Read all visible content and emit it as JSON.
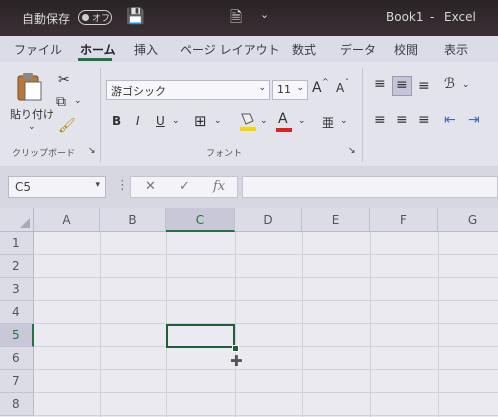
{
  "titlebar": {
    "autosave_label": "自動保存",
    "autosave_state": "オフ",
    "doc_title": "Book1",
    "separator": "-",
    "app_name": "Excel"
  },
  "ribbon_tabs": [
    "ファイル",
    "ホーム",
    "挿入",
    "ページ レイアウト",
    "数式",
    "データ",
    "校閲",
    "表示"
  ],
  "active_tab": "ホーム",
  "clipboard": {
    "paste_label": "貼り付け",
    "group_label": "クリップボード"
  },
  "font": {
    "family": "游ゴシック",
    "size": "11",
    "grow_label": "A",
    "shrink_label": "A",
    "bold": "B",
    "italic": "I",
    "underline": "U",
    "font_color_letter": "A",
    "phonetic_label": "亜",
    "group_label": "フォント",
    "accent_underline": "#e02020",
    "fill_color": "#f5d800"
  },
  "formula_bar": {
    "name_box": "C5",
    "cancel": "✕",
    "enter": "✓",
    "fx": "fx",
    "formula": ""
  },
  "sheet": {
    "columns": [
      "A",
      "B",
      "C",
      "D",
      "E",
      "F",
      "G"
    ],
    "rows": [
      "1",
      "2",
      "3",
      "4",
      "5",
      "6",
      "7",
      "8"
    ],
    "active_cell": "C5",
    "active_col": "C",
    "active_row": "5",
    "accent": "#217346"
  }
}
